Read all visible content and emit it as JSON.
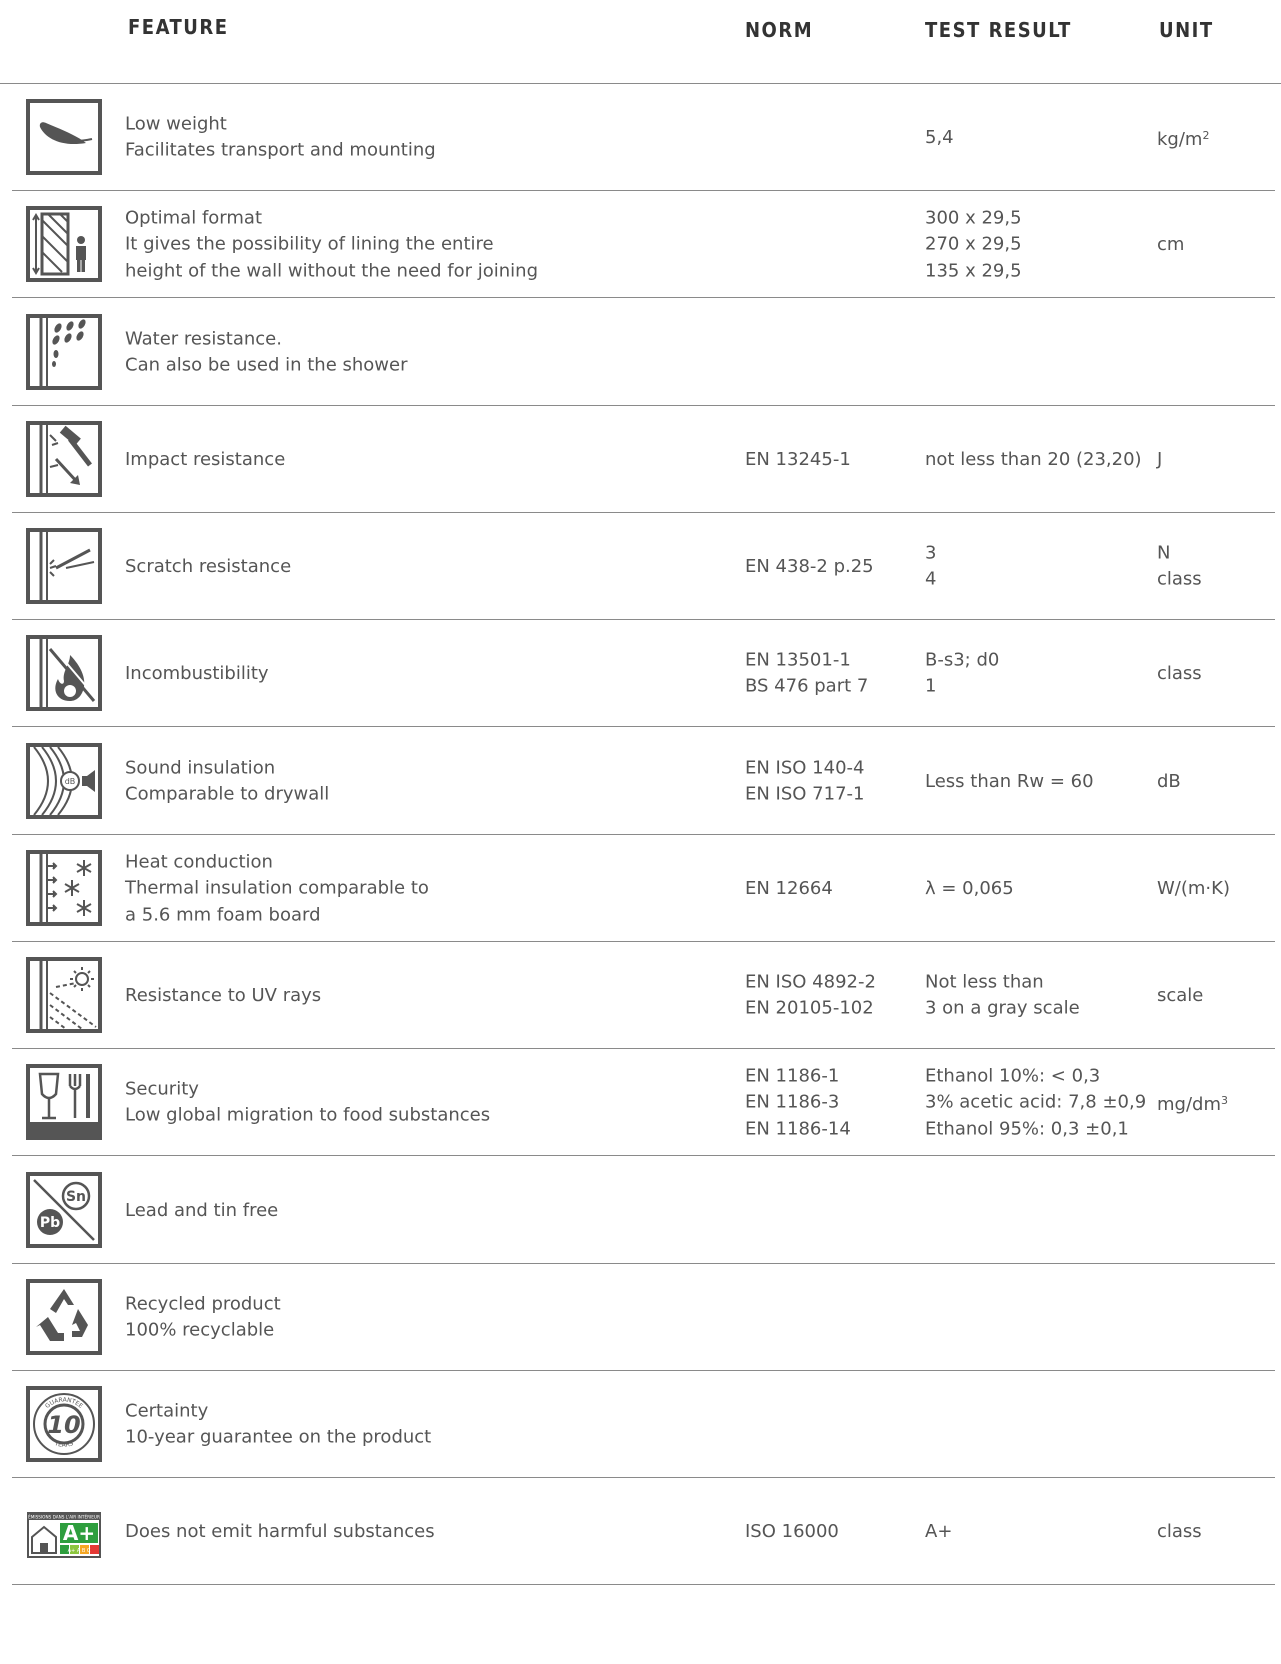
{
  "header": {
    "feature": "FEATURE",
    "norm": "NORM",
    "test_result": "TEST RESULT",
    "unit": "UNIT"
  },
  "rows": [
    {
      "icon": "feather-icon",
      "feature": [
        "Low weight",
        "Facilitates transport and mounting"
      ],
      "norm": [],
      "result": [
        "5,4"
      ],
      "unit": [
        "kg/m²"
      ]
    },
    {
      "icon": "format-height-person-icon",
      "feature": [
        "Optimal format",
        "It gives the possibility of lining the entire",
        "height of the wall without the need for joining"
      ],
      "norm": [],
      "result": [
        "300 x 29,5",
        "270 x 29,5",
        "135 x 29,5"
      ],
      "unit": [
        "cm"
      ]
    },
    {
      "icon": "water-drops-icon",
      "feature": [
        "Water resistance.",
        "Can also be used in the shower"
      ],
      "norm": [],
      "result": [],
      "unit": []
    },
    {
      "icon": "hammer-impact-icon",
      "feature": [
        "Impact resistance"
      ],
      "norm": [
        "EN 13245-1"
      ],
      "result": [
        "not less than 20 (23,20)"
      ],
      "unit": [
        "J"
      ]
    },
    {
      "icon": "scratch-needle-icon",
      "feature": [
        "Scratch resistance"
      ],
      "norm": [
        "EN 438-2 p.25"
      ],
      "result": [
        "3",
        "4"
      ],
      "unit": [
        "N",
        "class"
      ]
    },
    {
      "icon": "no-fire-icon",
      "feature": [
        "Incombustibility"
      ],
      "norm": [
        "EN 13501-1",
        "BS 476 part 7"
      ],
      "result": [
        "B-s3; d0",
        "1"
      ],
      "unit": [
        "class"
      ]
    },
    {
      "icon": "sound-waves-icon",
      "feature": [
        "Sound insulation",
        "Comparable to drywall"
      ],
      "norm": [
        "EN ISO 140-4",
        "EN ISO 717-1"
      ],
      "result": [
        "Less than Rw = 60"
      ],
      "unit": [
        "dB"
      ]
    },
    {
      "icon": "heat-snowflake-icon",
      "feature": [
        "Heat conduction",
        "Thermal insulation comparable to",
        "a 5.6 mm foam board"
      ],
      "norm": [
        "EN 12664"
      ],
      "result": [
        "λ = 0,065"
      ],
      "unit": [
        "W/(m·K)"
      ]
    },
    {
      "icon": "sun-uv-icon",
      "feature": [
        "Resistance to UV rays"
      ],
      "norm": [
        "EN ISO 4892-2",
        "EN 20105-102"
      ],
      "result": [
        "Not less than",
        "3 on a gray scale"
      ],
      "unit": [
        "scale"
      ]
    },
    {
      "icon": "glass-fork-icon",
      "feature": [
        "Security",
        "Low global migration to food substances"
      ],
      "norm": [
        "EN 1186-1",
        "EN 1186-3",
        "EN 1186-14"
      ],
      "result": [
        "Ethanol 10%: < 0,3",
        "3% acetic acid: 7,8 ±0,9",
        "Ethanol 95%: 0,3 ±0,1"
      ],
      "unit": [
        "mg/dm³"
      ]
    },
    {
      "icon": "lead-tin-free-icon",
      "feature": [
        "Lead and tin free"
      ],
      "norm": [],
      "result": [],
      "unit": []
    },
    {
      "icon": "recycle-icon",
      "feature": [
        "Recycled product",
        "100% recyclable"
      ],
      "norm": [],
      "result": [],
      "unit": []
    },
    {
      "icon": "guarantee-10-icon",
      "feature": [
        "Certainty",
        "10-year guarantee on the product"
      ],
      "norm": [],
      "result": [],
      "unit": []
    },
    {
      "icon": "emission-label-icon",
      "feature": [
        "Does not emit harmful substances"
      ],
      "norm": [
        "ISO 16000"
      ],
      "result": [
        "A+"
      ],
      "unit": [
        "class"
      ]
    }
  ],
  "icons_text": {
    "sound_db": "dB",
    "pb": "Pb",
    "sn": "Sn",
    "guarantee_num": "10",
    "guarantee_top": "GUARANTEE",
    "guarantee_bottom": "YEARS",
    "emission_grade": "A+",
    "emission_header": "ÉMISSIONS DANS L'AIR INTÉRIEUR",
    "emission_scale": "A+ A B C"
  }
}
